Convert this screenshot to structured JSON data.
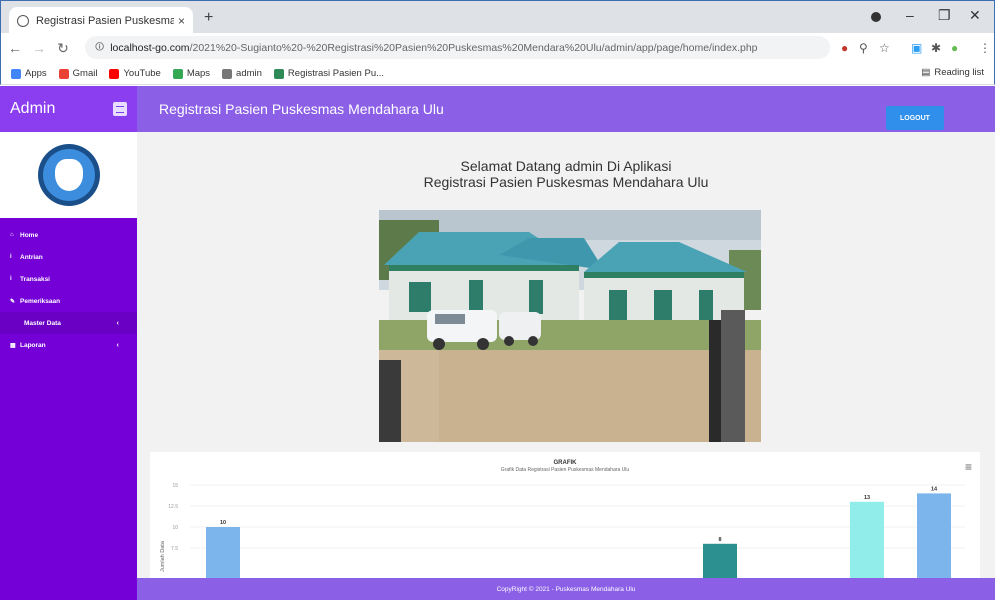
{
  "browser": {
    "tab_title": "Registrasi Pasien Puskesmas Me",
    "tab_close": "×",
    "new_tab": "+",
    "url_host": "localhost-go.com",
    "url_path": "/2021%20-Sugianto%20-%20Registrasi%20Pasien%20Puskesmas%20Mendara%20Ulu/admin/app/page/home/index.php",
    "bookmarks": [
      {
        "label": "Apps",
        "color": "#4285f4"
      },
      {
        "label": "Gmail",
        "color": "#ea4335"
      },
      {
        "label": "YouTube",
        "color": "#ff0000"
      },
      {
        "label": "Maps",
        "color": "#34a853"
      },
      {
        "label": "admin",
        "color": "#777777"
      },
      {
        "label": "Registrasi Pasien Pu...",
        "color": "#2e8b57"
      }
    ],
    "reading_list": "Reading list"
  },
  "sidebar": {
    "brand": "Admin",
    "items": [
      {
        "label": "Home",
        "icon": "home-icon",
        "glyph": "⌂"
      },
      {
        "label": "Antrian",
        "icon": "user-icon",
        "glyph": "i"
      },
      {
        "label": "Transaksi",
        "icon": "user-icon",
        "glyph": "i"
      },
      {
        "label": "Pemeriksaan",
        "icon": "edit-icon",
        "glyph": "✎"
      },
      {
        "label": "Master Data",
        "icon": "",
        "glyph": "",
        "chevron": "‹",
        "sub": true
      },
      {
        "label": "Laporan",
        "icon": "calendar-icon",
        "glyph": "▦",
        "chevron": "‹"
      }
    ]
  },
  "header": {
    "title": "Registrasi Pasien Puskesmas Mendahara Ulu",
    "logout_label": "LOGOUT"
  },
  "main": {
    "welcome_line1": "Selamat Datang admin Di Aplikasi",
    "welcome_line2": "Registrasi Pasien Puskesmas Mendahara Ulu"
  },
  "chart_data": {
    "type": "bar",
    "title": "GRAFIK",
    "subtitle": "Grafik Data Registrasi Pasien Puskesmas Mendahara Ulu",
    "ylabel": "Jumlah Data",
    "yticks": [
      "15",
      "12.5",
      "10",
      "7.5"
    ],
    "ylim": [
      7.5,
      15
    ],
    "values": [
      10,
      8,
      13,
      14
    ],
    "colors": [
      "#7cb5ec",
      "#2b908f",
      "#90ede9",
      "#7cb5ec"
    ]
  },
  "footer": {
    "text": "CopyRight © 2021 - Puskesmas Mendahara Ulu"
  }
}
